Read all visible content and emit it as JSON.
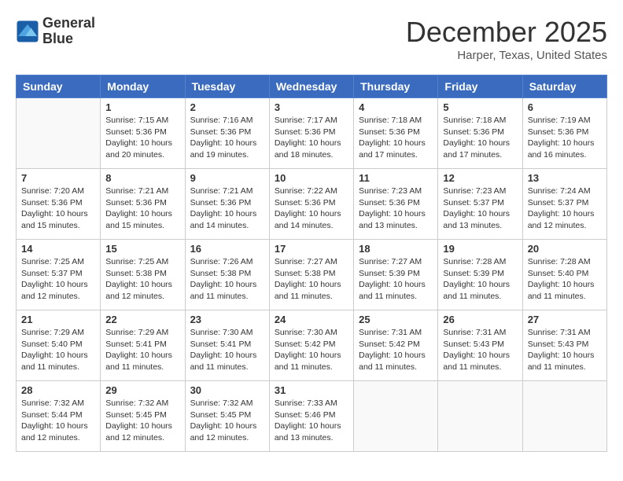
{
  "header": {
    "logo_line1": "General",
    "logo_line2": "Blue",
    "month": "December 2025",
    "location": "Harper, Texas, United States"
  },
  "days_of_week": [
    "Sunday",
    "Monday",
    "Tuesday",
    "Wednesday",
    "Thursday",
    "Friday",
    "Saturday"
  ],
  "weeks": [
    [
      {
        "num": "",
        "info": ""
      },
      {
        "num": "1",
        "info": "Sunrise: 7:15 AM\nSunset: 5:36 PM\nDaylight: 10 hours\nand 20 minutes."
      },
      {
        "num": "2",
        "info": "Sunrise: 7:16 AM\nSunset: 5:36 PM\nDaylight: 10 hours\nand 19 minutes."
      },
      {
        "num": "3",
        "info": "Sunrise: 7:17 AM\nSunset: 5:36 PM\nDaylight: 10 hours\nand 18 minutes."
      },
      {
        "num": "4",
        "info": "Sunrise: 7:18 AM\nSunset: 5:36 PM\nDaylight: 10 hours\nand 17 minutes."
      },
      {
        "num": "5",
        "info": "Sunrise: 7:18 AM\nSunset: 5:36 PM\nDaylight: 10 hours\nand 17 minutes."
      },
      {
        "num": "6",
        "info": "Sunrise: 7:19 AM\nSunset: 5:36 PM\nDaylight: 10 hours\nand 16 minutes."
      }
    ],
    [
      {
        "num": "7",
        "info": "Sunrise: 7:20 AM\nSunset: 5:36 PM\nDaylight: 10 hours\nand 15 minutes."
      },
      {
        "num": "8",
        "info": "Sunrise: 7:21 AM\nSunset: 5:36 PM\nDaylight: 10 hours\nand 15 minutes."
      },
      {
        "num": "9",
        "info": "Sunrise: 7:21 AM\nSunset: 5:36 PM\nDaylight: 10 hours\nand 14 minutes."
      },
      {
        "num": "10",
        "info": "Sunrise: 7:22 AM\nSunset: 5:36 PM\nDaylight: 10 hours\nand 14 minutes."
      },
      {
        "num": "11",
        "info": "Sunrise: 7:23 AM\nSunset: 5:36 PM\nDaylight: 10 hours\nand 13 minutes."
      },
      {
        "num": "12",
        "info": "Sunrise: 7:23 AM\nSunset: 5:37 PM\nDaylight: 10 hours\nand 13 minutes."
      },
      {
        "num": "13",
        "info": "Sunrise: 7:24 AM\nSunset: 5:37 PM\nDaylight: 10 hours\nand 12 minutes."
      }
    ],
    [
      {
        "num": "14",
        "info": "Sunrise: 7:25 AM\nSunset: 5:37 PM\nDaylight: 10 hours\nand 12 minutes."
      },
      {
        "num": "15",
        "info": "Sunrise: 7:25 AM\nSunset: 5:38 PM\nDaylight: 10 hours\nand 12 minutes."
      },
      {
        "num": "16",
        "info": "Sunrise: 7:26 AM\nSunset: 5:38 PM\nDaylight: 10 hours\nand 11 minutes."
      },
      {
        "num": "17",
        "info": "Sunrise: 7:27 AM\nSunset: 5:38 PM\nDaylight: 10 hours\nand 11 minutes."
      },
      {
        "num": "18",
        "info": "Sunrise: 7:27 AM\nSunset: 5:39 PM\nDaylight: 10 hours\nand 11 minutes."
      },
      {
        "num": "19",
        "info": "Sunrise: 7:28 AM\nSunset: 5:39 PM\nDaylight: 10 hours\nand 11 minutes."
      },
      {
        "num": "20",
        "info": "Sunrise: 7:28 AM\nSunset: 5:40 PM\nDaylight: 10 hours\nand 11 minutes."
      }
    ],
    [
      {
        "num": "21",
        "info": "Sunrise: 7:29 AM\nSunset: 5:40 PM\nDaylight: 10 hours\nand 11 minutes."
      },
      {
        "num": "22",
        "info": "Sunrise: 7:29 AM\nSunset: 5:41 PM\nDaylight: 10 hours\nand 11 minutes."
      },
      {
        "num": "23",
        "info": "Sunrise: 7:30 AM\nSunset: 5:41 PM\nDaylight: 10 hours\nand 11 minutes."
      },
      {
        "num": "24",
        "info": "Sunrise: 7:30 AM\nSunset: 5:42 PM\nDaylight: 10 hours\nand 11 minutes."
      },
      {
        "num": "25",
        "info": "Sunrise: 7:31 AM\nSunset: 5:42 PM\nDaylight: 10 hours\nand 11 minutes."
      },
      {
        "num": "26",
        "info": "Sunrise: 7:31 AM\nSunset: 5:43 PM\nDaylight: 10 hours\nand 11 minutes."
      },
      {
        "num": "27",
        "info": "Sunrise: 7:31 AM\nSunset: 5:43 PM\nDaylight: 10 hours\nand 11 minutes."
      }
    ],
    [
      {
        "num": "28",
        "info": "Sunrise: 7:32 AM\nSunset: 5:44 PM\nDaylight: 10 hours\nand 12 minutes."
      },
      {
        "num": "29",
        "info": "Sunrise: 7:32 AM\nSunset: 5:45 PM\nDaylight: 10 hours\nand 12 minutes."
      },
      {
        "num": "30",
        "info": "Sunrise: 7:32 AM\nSunset: 5:45 PM\nDaylight: 10 hours\nand 12 minutes."
      },
      {
        "num": "31",
        "info": "Sunrise: 7:33 AM\nSunset: 5:46 PM\nDaylight: 10 hours\nand 13 minutes."
      },
      {
        "num": "",
        "info": ""
      },
      {
        "num": "",
        "info": ""
      },
      {
        "num": "",
        "info": ""
      }
    ]
  ]
}
